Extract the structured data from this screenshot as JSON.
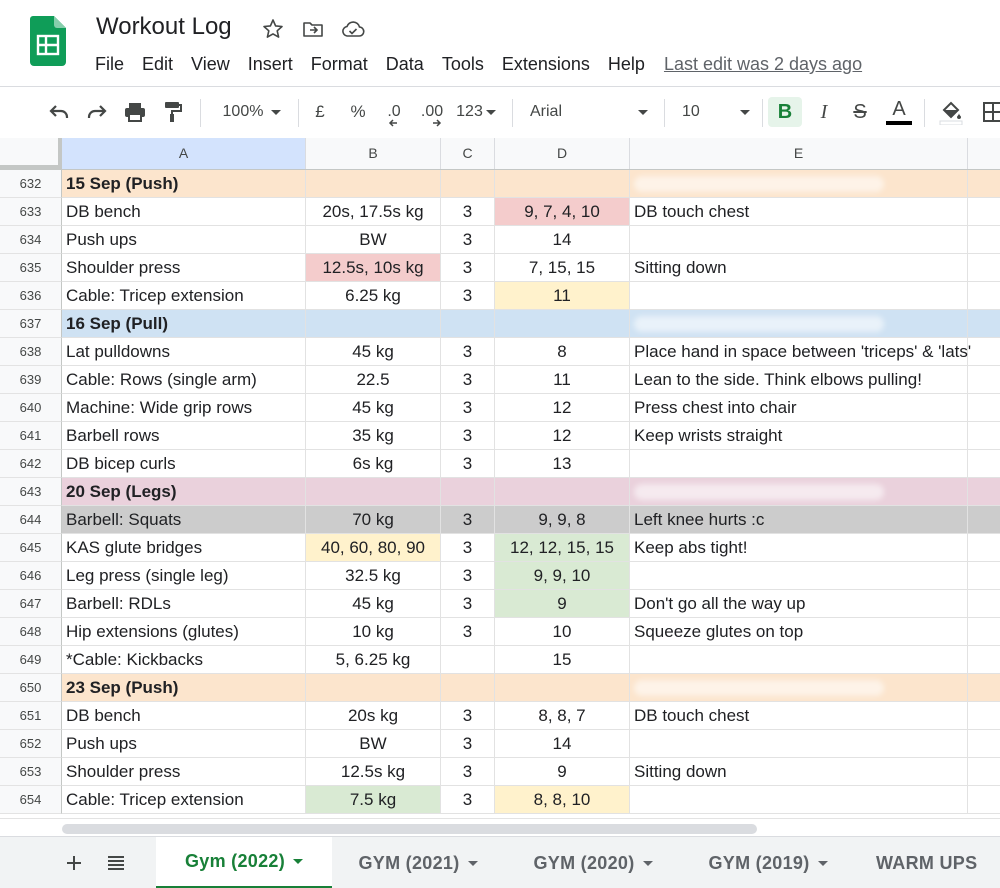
{
  "app": {
    "title": "Workout Log",
    "menu": [
      "File",
      "Edit",
      "View",
      "Insert",
      "Format",
      "Data",
      "Tools",
      "Extensions",
      "Help"
    ],
    "last_edit": "Last edit was 2 days ago"
  },
  "toolbar": {
    "zoom": "100%",
    "currency": "£",
    "percent": "%",
    "dec_decrease": ".0",
    "dec_increase": ".00",
    "format_more": "123",
    "font": "Arial",
    "font_size": "10",
    "bold": "B",
    "italic": "I",
    "strike": "S",
    "text_color": "A"
  },
  "grid": {
    "columns": [
      "A",
      "B",
      "C",
      "D",
      "E"
    ],
    "active_column": "A",
    "rows": [
      {
        "n": "632",
        "A": "15 Sep (Push)",
        "B": "",
        "C": "",
        "D": "",
        "E": "",
        "header": true,
        "bg": "#fce5cd"
      },
      {
        "n": "633",
        "A": "DB bench",
        "B": "20s, 17.5s kg",
        "C": "3",
        "D": "9, 7, 4, 10",
        "E": "DB touch chest",
        "Dbg": "#f4cccc"
      },
      {
        "n": "634",
        "A": "Push ups",
        "B": "BW",
        "C": "3",
        "D": "14",
        "E": ""
      },
      {
        "n": "635",
        "A": "Shoulder press",
        "B": "12.5s, 10s kg",
        "C": "3",
        "D": "7, 15, 15",
        "E": "Sitting down",
        "Bbg": "#f4cccc"
      },
      {
        "n": "636",
        "A": "Cable: Tricep extension",
        "B": "6.25 kg",
        "C": "3",
        "D": "11",
        "E": "",
        "Dbg": "#fff2cc"
      },
      {
        "n": "637",
        "A": "16 Sep (Pull)",
        "B": "",
        "C": "",
        "D": "",
        "E": "",
        "header": true,
        "bg": "#cfe2f3"
      },
      {
        "n": "638",
        "A": "Lat pulldowns",
        "B": "45 kg",
        "C": "3",
        "D": "8",
        "E": "Place hand in space between 'triceps' & 'lats'"
      },
      {
        "n": "639",
        "A": "Cable: Rows (single arm)",
        "B": "22.5",
        "C": "3",
        "D": "11",
        "E": "Lean to the side. Think elbows pulling!"
      },
      {
        "n": "640",
        "A": "Machine: Wide grip rows",
        "B": "45 kg",
        "C": "3",
        "D": "12",
        "E": "Press chest into chair"
      },
      {
        "n": "641",
        "A": "Barbell rows",
        "B": "35 kg",
        "C": "3",
        "D": "12",
        "E": "Keep wrists straight"
      },
      {
        "n": "642",
        "A": "DB bicep curls",
        "B": "6s kg",
        "C": "3",
        "D": "13",
        "E": ""
      },
      {
        "n": "643",
        "A": "20 Sep (Legs)",
        "B": "",
        "C": "",
        "D": "",
        "E": "",
        "header": true,
        "bg": "#ead1dc"
      },
      {
        "n": "644",
        "A": "Barbell: Squats",
        "B": "70 kg",
        "C": "3",
        "D": "9, 9, 8",
        "E": "Left knee hurts :c",
        "bg": "#cccccc"
      },
      {
        "n": "645",
        "A": "KAS glute bridges",
        "B": "40, 60, 80, 90",
        "C": "3",
        "D": "12, 12, 15, 15",
        "E": "Keep abs tight!",
        "Bbg": "#fff2cc",
        "Dbg": "#d9ead3"
      },
      {
        "n": "646",
        "A": "Leg press (single leg)",
        "B": "32.5 kg",
        "C": "3",
        "D": "9, 9, 10",
        "E": "",
        "Dbg": "#d9ead3"
      },
      {
        "n": "647",
        "A": "Barbell: RDLs",
        "B": "45 kg",
        "C": "3",
        "D": "9",
        "E": "Don't go all the way up",
        "Dbg": "#d9ead3"
      },
      {
        "n": "648",
        "A": "Hip extensions (glutes)",
        "B": "10 kg",
        "C": "3",
        "D": "10",
        "E": "Squeeze glutes on top"
      },
      {
        "n": "649",
        "A": "*Cable: Kickbacks",
        "B": "5, 6.25 kg",
        "C": "",
        "D": "15",
        "E": ""
      },
      {
        "n": "650",
        "A": "23 Sep (Push)",
        "B": "",
        "C": "",
        "D": "",
        "E": "",
        "header": true,
        "bg": "#fce5cd"
      },
      {
        "n": "651",
        "A": "DB bench",
        "B": "20s kg",
        "C": "3",
        "D": "8, 8, 7",
        "E": "DB touch chest"
      },
      {
        "n": "652",
        "A": "Push ups",
        "B": "BW",
        "C": "3",
        "D": "14",
        "E": ""
      },
      {
        "n": "653",
        "A": "Shoulder press",
        "B": "12.5s kg",
        "C": "3",
        "D": "9",
        "E": "Sitting down"
      },
      {
        "n": "654",
        "A": "Cable: Tricep extension",
        "B": "7.5 kg",
        "C": "3",
        "D": "8, 8, 10",
        "E": "",
        "Bbg": "#d9ead3",
        "Dbg": "#fff2cc"
      }
    ]
  },
  "tabs": [
    {
      "label": "Gym (2022)",
      "active": true
    },
    {
      "label": "GYM (2021)",
      "active": false
    },
    {
      "label": "GYM (2020)",
      "active": false
    },
    {
      "label": "GYM (2019)",
      "active": false
    },
    {
      "label": "WARM UPS",
      "active": false
    }
  ],
  "colors": {
    "brand": "#0f9d58",
    "active_tab": "#188038",
    "bold_active": "#e6f4ea"
  }
}
